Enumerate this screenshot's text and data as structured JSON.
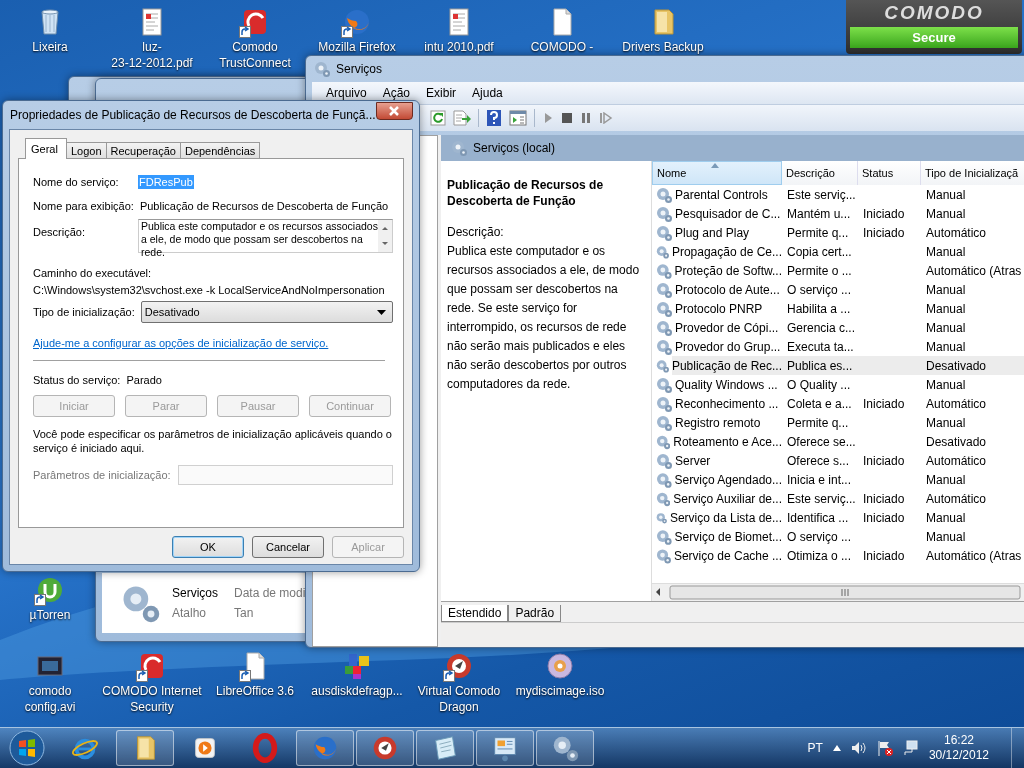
{
  "desktop_icons": [
    {
      "kind": "recycle-bin",
      "shortcut": false,
      "lines": [
        "Lixeira"
      ]
    },
    {
      "kind": "pdf",
      "shortcut": false,
      "lines": [
        "luz-",
        "23-12-2012.pdf"
      ]
    },
    {
      "kind": "comodo-red",
      "shortcut": true,
      "lines": [
        "Comodo",
        "TrustConnect"
      ]
    },
    {
      "kind": "firefox",
      "shortcut": true,
      "lines": [
        "Mozilla Firefox"
      ]
    },
    {
      "kind": "pdf",
      "shortcut": false,
      "lines": [
        "intu 2010.pdf"
      ]
    },
    {
      "kind": "document",
      "shortcut": false,
      "lines": [
        "COMODO -"
      ]
    },
    {
      "kind": "folder",
      "shortcut": false,
      "lines": [
        "Drivers Backup"
      ]
    }
  ],
  "desktop_icons_bottom": [
    {
      "kind": "video",
      "shortcut": false,
      "lines": [
        "comodo",
        "config.avi"
      ]
    },
    {
      "kind": "comodo-red",
      "shortcut": true,
      "lines": [
        "COMODO Internet",
        "Security"
      ]
    },
    {
      "kind": "document",
      "shortcut": true,
      "lines": [
        "LibreOffice 3.6"
      ]
    },
    {
      "kind": "blocks",
      "shortcut": false,
      "lines": [
        "ausdiskdefragp..."
      ]
    },
    {
      "kind": "dragon",
      "shortcut": true,
      "lines": [
        "Virtual Comodo",
        "Dragon"
      ]
    },
    {
      "kind": "disc",
      "shortcut": false,
      "lines": [
        "mydiscimage.iso"
      ]
    }
  ],
  "side_icon": {
    "kind": "utorrent",
    "shortcut": true,
    "lines": [
      "µTorren"
    ]
  },
  "comodo_widget": {
    "brand": "COMODO",
    "status": "Secure"
  },
  "explorer_window": {
    "name": "Serviços",
    "modified": "Data de modi",
    "type": "Atalho",
    "size": "Tan"
  },
  "services_window": {
    "title": "Serviços",
    "menu": [
      "Arquivo",
      "Ação",
      "Exibir",
      "Ajuda"
    ],
    "header": "Serviços (local)",
    "detail": {
      "title": "Publicação de Recursos de Descoberta de Função",
      "description_label": "Descrição:",
      "description": "Publica este computador e os recursos associados a ele, de modo que possam ser descobertos na rede. Se este serviço for interrompido, os recursos de rede não serão mais publicados e eles não serão descobertos por outros computadores da rede."
    },
    "columns": [
      {
        "label": "Nome",
        "sorted": true
      },
      {
        "label": "Descrição",
        "sorted": false
      },
      {
        "label": "Status",
        "sorted": false
      },
      {
        "label": "Tipo de Inicializaçã",
        "sorted": false
      }
    ],
    "rows": [
      {
        "name": "Parental Controls",
        "description": "Este serviç...",
        "status": "",
        "startup": "Manual",
        "selected": false
      },
      {
        "name": "Pesquisador de C...",
        "description": "Mantém u...",
        "status": "Iniciado",
        "startup": "Manual",
        "selected": false
      },
      {
        "name": "Plug and Play",
        "description": "Permite q...",
        "status": "Iniciado",
        "startup": "Automático",
        "selected": false
      },
      {
        "name": "Propagação de Ce...",
        "description": "Copia cert...",
        "status": "",
        "startup": "Manual",
        "selected": false
      },
      {
        "name": "Proteção de Softw...",
        "description": "Permite o ...",
        "status": "",
        "startup": "Automático (Atras",
        "selected": false
      },
      {
        "name": "Protocolo de Aute...",
        "description": "O serviço ...",
        "status": "",
        "startup": "Manual",
        "selected": false
      },
      {
        "name": "Protocolo PNRP",
        "description": "Habilita a ...",
        "status": "",
        "startup": "Manual",
        "selected": false
      },
      {
        "name": "Provedor de Cópi...",
        "description": "Gerencia c...",
        "status": "",
        "startup": "Manual",
        "selected": false
      },
      {
        "name": "Provedor do Grup...",
        "description": "Executa ta...",
        "status": "",
        "startup": "Manual",
        "selected": false
      },
      {
        "name": "Publicação de Rec...",
        "description": "Publica es...",
        "status": "",
        "startup": "Desativado",
        "selected": true
      },
      {
        "name": "Quality Windows ...",
        "description": "O Quality ...",
        "status": "",
        "startup": "Manual",
        "selected": false
      },
      {
        "name": "Reconhecimento ...",
        "description": "Coleta e a...",
        "status": "Iniciado",
        "startup": "Automático",
        "selected": false
      },
      {
        "name": "Registro remoto",
        "description": "Permite q...",
        "status": "",
        "startup": "Manual",
        "selected": false
      },
      {
        "name": "Roteamento e Ace...",
        "description": "Oferece se...",
        "status": "",
        "startup": "Desativado",
        "selected": false
      },
      {
        "name": "Server",
        "description": "Oferece s...",
        "status": "Iniciado",
        "startup": "Automático",
        "selected": false
      },
      {
        "name": "Serviço Agendado...",
        "description": "Inicia e int...",
        "status": "",
        "startup": "Manual",
        "selected": false
      },
      {
        "name": "Serviço Auxiliar de...",
        "description": "Este serviç...",
        "status": "Iniciado",
        "startup": "Automático",
        "selected": false
      },
      {
        "name": "Serviço da Lista de...",
        "description": "Identifica ...",
        "status": "Iniciado",
        "startup": "Manual",
        "selected": false
      },
      {
        "name": "Serviço de Biomet...",
        "description": "O serviço ...",
        "status": "",
        "startup": "Manual",
        "selected": false
      },
      {
        "name": "Serviço de Cache ...",
        "description": "Otimiza o ...",
        "status": "Iniciado",
        "startup": "Automático (Atras",
        "selected": false
      }
    ],
    "view_tabs": [
      {
        "label": "Estendido",
        "selected": true
      },
      {
        "label": "Padrão",
        "selected": false
      }
    ]
  },
  "dialog": {
    "title": "Propriedades de Publicação de Recursos de Descoberta de Funçã...",
    "tabs": [
      {
        "label": "Geral",
        "selected": true
      },
      {
        "label": "Logon",
        "selected": false
      },
      {
        "label": "Recuperação",
        "selected": false
      },
      {
        "label": "Dependências",
        "selected": false
      }
    ],
    "service_name_label": "Nome do serviço:",
    "service_name": "FDResPub",
    "display_name_label": "Nome para exibição:",
    "display_name": "Publicação de Recursos de Descoberta de Função",
    "description_label": "Descrição:",
    "description": "Publica este computador e os recursos associados a ele, de modo que possam ser descobertos na rede.",
    "path_label": "Caminho do executável:",
    "path": "C:\\Windows\\system32\\svchost.exe -k LocalServiceAndNoImpersonation",
    "startup_type_label": "Tipo de inicialização:",
    "startup_type": "Desativado",
    "help_link": "Ajude-me a configurar as opções de inicialização de serviço.",
    "status_label": "Status do serviço:",
    "status": "Parado",
    "service_buttons": [
      {
        "label": "Iniciar",
        "disabled": true
      },
      {
        "label": "Parar",
        "disabled": true
      },
      {
        "label": "Pausar",
        "disabled": true
      },
      {
        "label": "Continuar",
        "disabled": true
      }
    ],
    "params_note": "Você pode especificar os parâmetros de inicialização aplicáveis quando o serviço é iniciado aqui.",
    "params_label": "Parâmetros de inicialização:",
    "params_disabled": true,
    "buttons": [
      {
        "label": "OK",
        "disabled": false,
        "default": true
      },
      {
        "label": "Cancelar",
        "disabled": false,
        "default": false
      },
      {
        "label": "Aplicar",
        "disabled": true,
        "default": false
      }
    ]
  },
  "taskbar": {
    "items": [
      {
        "kind": "ie",
        "running": false
      },
      {
        "kind": "folder",
        "running": true
      },
      {
        "kind": "media",
        "running": false
      },
      {
        "kind": "opera",
        "running": false
      },
      {
        "kind": "firefox",
        "running": true
      },
      {
        "kind": "dragon",
        "running": true
      },
      {
        "kind": "notepad",
        "running": true
      },
      {
        "kind": "panel",
        "running": true
      },
      {
        "kind": "gears",
        "running": true
      }
    ],
    "language": "PT",
    "time": "16:22",
    "date": "30/12/2012"
  }
}
